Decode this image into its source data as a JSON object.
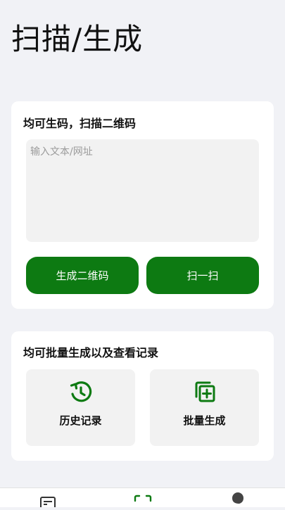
{
  "header": {
    "title": "扫描/生成"
  },
  "generate_card": {
    "title": "均可生码，扫描二维码",
    "input": {
      "value": "",
      "placeholder": "输入文本/网址"
    },
    "generate_button": "生成二维码",
    "scan_button": "扫一扫"
  },
  "batch_card": {
    "title": "均可批量生成以及查看记录",
    "tiles": [
      {
        "label": "历史记录",
        "icon": "history-clock-icon"
      },
      {
        "label": "批量生成",
        "icon": "batch-add-icon"
      }
    ]
  },
  "bottom_nav": {
    "items": [
      {
        "icon": "document-icon"
      },
      {
        "icon": "scan-icon",
        "active": true
      },
      {
        "icon": "profile-icon"
      }
    ]
  },
  "colors": {
    "accent": "#0d7a12",
    "background": "#f1f2f6",
    "card": "#ffffff",
    "field": "#f2f2f2"
  }
}
